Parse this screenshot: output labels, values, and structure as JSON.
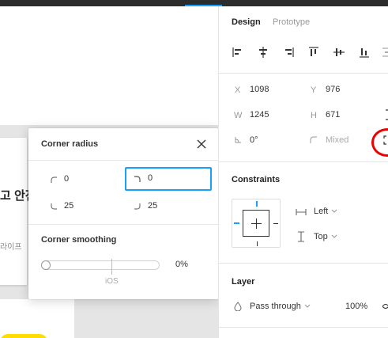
{
  "canvas": {
    "card_title": "고 안전",
    "card_subtitle": "라이프"
  },
  "popup": {
    "title": "Corner radius",
    "top_left": "0",
    "top_right": "0",
    "bottom_left": "25",
    "bottom_right": "25",
    "smoothing_title": "Corner smoothing",
    "smoothing_value": "0%",
    "smoothing_fraction": 0,
    "ios_label": "iOS"
  },
  "panel": {
    "tabs": [
      {
        "label": "Design",
        "active": true
      },
      {
        "label": "Prototype",
        "active": false
      }
    ],
    "x_label": "X",
    "x_value": "1098",
    "y_label": "Y",
    "y_value": "976",
    "w_label": "W",
    "w_value": "1245",
    "h_label": "H",
    "h_value": "671",
    "rotation_value": "0°",
    "radius_value": "Mixed",
    "constraints_title": "Constraints",
    "horizontal_constraint": "Left",
    "vertical_constraint": "Top",
    "layer_title": "Layer",
    "blend_mode": "Pass through",
    "opacity": "100%"
  },
  "colors": {
    "accent": "#18a0fb",
    "annotation": "#ee0000",
    "highlight_yellow": "#ffdd00"
  }
}
